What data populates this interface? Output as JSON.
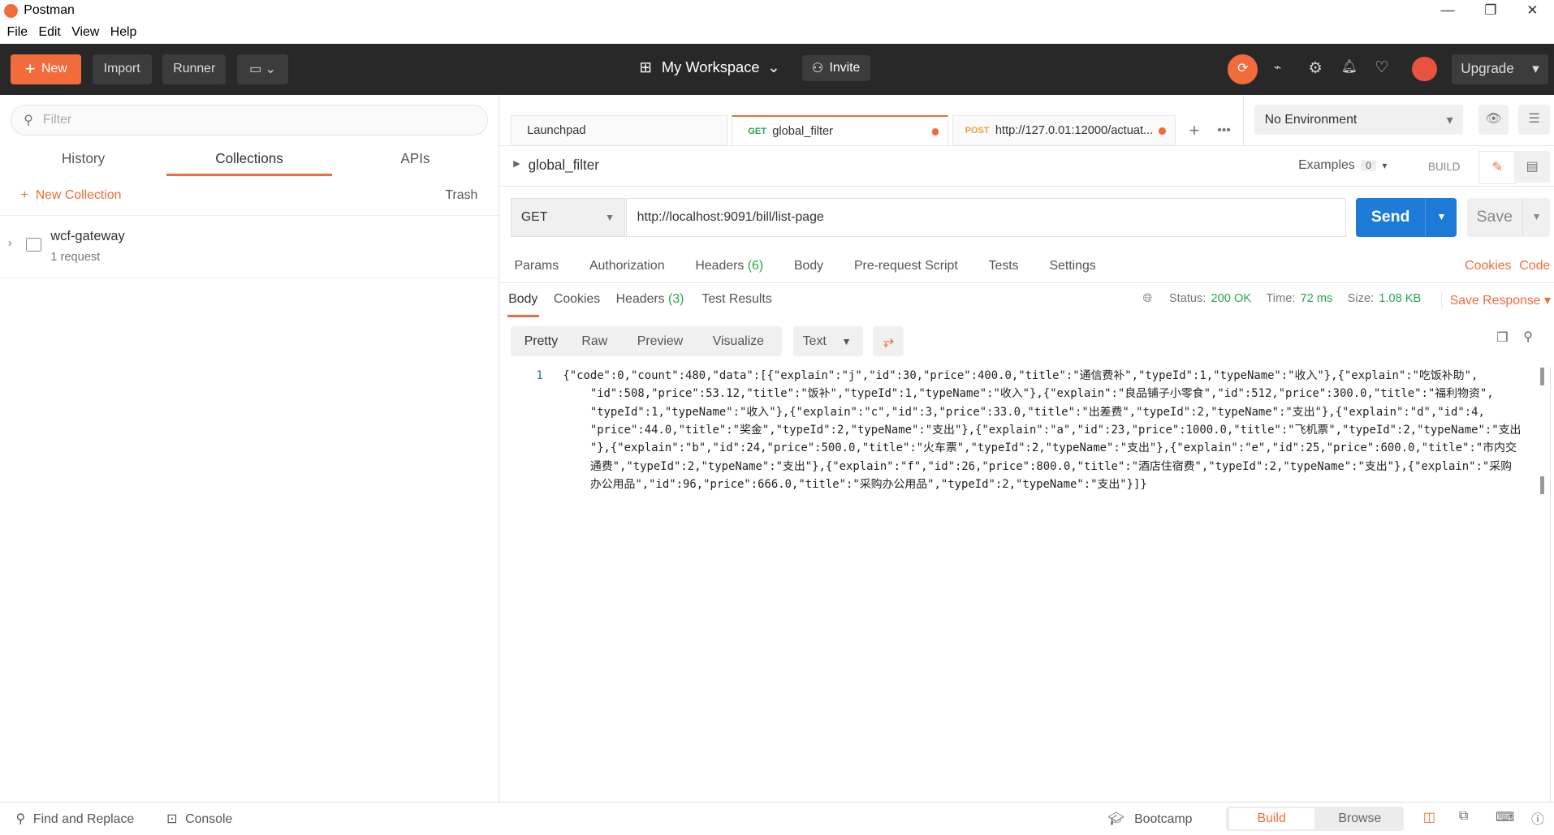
{
  "app": {
    "title": "Postman",
    "accent": "#f26b3a"
  },
  "menu": [
    "File",
    "Edit",
    "View",
    "Help"
  ],
  "toolbar": {
    "new": "New",
    "import": "Import",
    "runner": "Runner",
    "workspace": "My Workspace",
    "invite": "Invite",
    "upgrade": "Upgrade"
  },
  "sidebar": {
    "filter_placeholder": "Filter",
    "tabs": [
      "History",
      "Collections",
      "APIs"
    ],
    "active_tab": "Collections",
    "new_collection": "New Collection",
    "trash": "Trash",
    "collections": [
      {
        "name": "wcf-gateway",
        "meta": "1 request"
      }
    ]
  },
  "tabs": [
    {
      "label": "Launchpad"
    },
    {
      "method": "GET",
      "label": "global_filter",
      "unsaved": true
    },
    {
      "method": "POST",
      "label": "http://127.0.01:12000/actuat...",
      "unsaved": true
    }
  ],
  "environment": "No Environment",
  "request": {
    "name": "global_filter",
    "examples_label": "Examples",
    "examples_count": "0",
    "build": "BUILD",
    "method": "GET",
    "url": "http://localhost:9091/bill/list-page",
    "send": "Send",
    "save": "Save",
    "tabs": [
      {
        "label": "Params"
      },
      {
        "label": "Authorization"
      },
      {
        "label": "Headers",
        "count": "(6)"
      },
      {
        "label": "Body"
      },
      {
        "label": "Pre-request Script"
      },
      {
        "label": "Tests"
      },
      {
        "label": "Settings"
      }
    ],
    "cookies": "Cookies",
    "code": "Code"
  },
  "response": {
    "tabs": [
      {
        "label": "Body"
      },
      {
        "label": "Cookies"
      },
      {
        "label": "Headers",
        "count": "(3)"
      },
      {
        "label": "Test Results"
      }
    ],
    "status_label": "Status:",
    "status": "200 OK",
    "time_label": "Time:",
    "time": "72 ms",
    "size_label": "Size:",
    "size": "1.08 KB",
    "save_response": "Save Response",
    "formats": [
      "Pretty",
      "Raw",
      "Preview",
      "Visualize"
    ],
    "type": "Text",
    "line_number": "1",
    "lines": [
      "{\"code\":0,\"count\":480,\"data\":[{\"explain\":\"j\",\"id\":30,\"price\":400.0,\"title\":\"通信费补\",\"typeId\":1,\"typeName\":\"收入\"},{\"explain\":\"吃饭补助\",",
      "    \"id\":508,\"price\":53.12,\"title\":\"饭补\",\"typeId\":1,\"typeName\":\"收入\"},{\"explain\":\"良品铺子小零食\",\"id\":512,\"price\":300.0,\"title\":\"福利物资\",",
      "    \"typeId\":1,\"typeName\":\"收入\"},{\"explain\":\"c\",\"id\":3,\"price\":33.0,\"title\":\"出差费\",\"typeId\":2,\"typeName\":\"支出\"},{\"explain\":\"d\",\"id\":4,",
      "    \"price\":44.0,\"title\":\"奖金\",\"typeId\":2,\"typeName\":\"支出\"},{\"explain\":\"a\",\"id\":23,\"price\":1000.0,\"title\":\"飞机票\",\"typeId\":2,\"typeName\":\"支出",
      "    \"},{\"explain\":\"b\",\"id\":24,\"price\":500.0,\"title\":\"火车票\",\"typeId\":2,\"typeName\":\"支出\"},{\"explain\":\"e\",\"id\":25,\"price\":600.0,\"title\":\"市内交",
      "    通费\",\"typeId\":2,\"typeName\":\"支出\"},{\"explain\":\"f\",\"id\":26,\"price\":800.0,\"title\":\"酒店住宿费\",\"typeId\":2,\"typeName\":\"支出\"},{\"explain\":\"采购",
      "    办公用品\",\"id\":96,\"price\":666.0,\"title\":\"采购办公用品\",\"typeId\":2,\"typeName\":\"支出\"}]}"
    ]
  },
  "footer": {
    "find_replace": "Find and Replace",
    "console": "Console",
    "bootcamp": "Bootcamp",
    "build": "Build",
    "browse": "Browse"
  }
}
